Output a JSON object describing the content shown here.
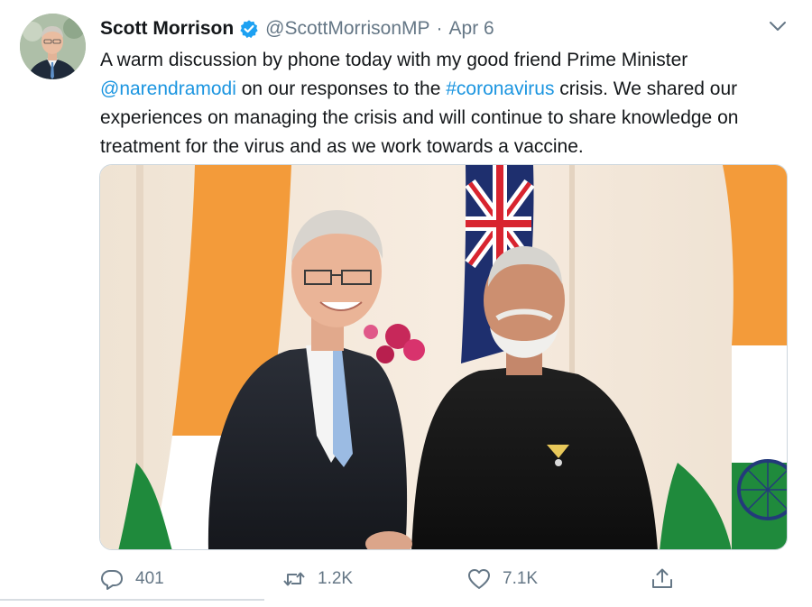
{
  "tweet": {
    "author_name": "Scott Morrison",
    "handle": "@ScottMorrisonMP",
    "separator": "·",
    "date": "Apr 6",
    "text": {
      "part1": "A warm discussion by phone today with my good friend Prime Minister ",
      "mention": "@narendramodi",
      "part2": " on our responses to the ",
      "hashtag": "#coronavirus",
      "part3": " crisis. We shared our experiences on managing the crisis and will continue to share knowledge on treatment for the virus and as we work towards a vaccine."
    },
    "verified": true,
    "media": {
      "image_kind": "photo-two-leaders-handshake"
    },
    "actions": {
      "reply": {
        "icon": "reply-icon",
        "count": "401"
      },
      "retweet": {
        "icon": "retweet-icon",
        "count": "1.2K"
      },
      "like": {
        "icon": "heart-icon",
        "count": "7.1K"
      },
      "share": {
        "icon": "share-icon",
        "count": ""
      }
    }
  },
  "colors": {
    "link": "#1b95e0",
    "muted": "#657786",
    "verified": "#1da1f2",
    "text": "#14171a"
  }
}
